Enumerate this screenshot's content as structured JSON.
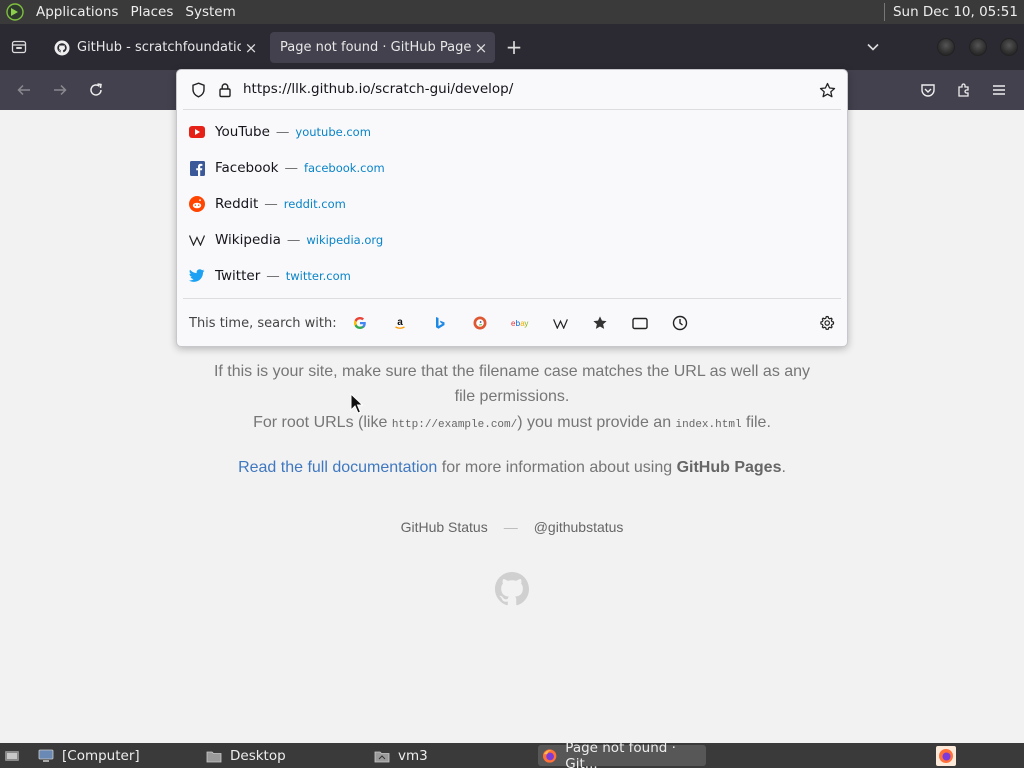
{
  "top_panel": {
    "menus": [
      "Applications",
      "Places",
      "System"
    ],
    "clock": "Sun Dec 10, 05:51"
  },
  "tabs": [
    {
      "title": "GitHub - scratchfoundation/",
      "close": "×"
    },
    {
      "title": "Page not found · GitHub Pages",
      "close": "×"
    }
  ],
  "new_tab": "+",
  "url_bar": {
    "value": "https://llk.github.io/scratch-gui/develop/"
  },
  "suggestions": [
    {
      "name": "YouTube",
      "sep": "—",
      "url": "youtube.com",
      "icon": "youtube-icon"
    },
    {
      "name": "Facebook",
      "sep": "—",
      "url": "facebook.com",
      "icon": "facebook-icon"
    },
    {
      "name": "Reddit",
      "sep": "—",
      "url": "reddit.com",
      "icon": "reddit-icon"
    },
    {
      "name": "Wikipedia",
      "sep": "—",
      "url": "wikipedia.org",
      "icon": "wikipedia-icon"
    },
    {
      "name": "Twitter",
      "sep": "—",
      "url": "twitter.com",
      "icon": "twitter-icon"
    }
  ],
  "search_with": {
    "label": "This time, search with:",
    "engines": [
      "google-icon",
      "amazon-icon",
      "bing-icon",
      "duckduckgo-icon",
      "ebay-icon",
      "wikipedia-icon",
      "bookmarks-icon",
      "tabs-icon",
      "history-icon"
    ]
  },
  "page": {
    "line1": "If this is your site, make sure that the filename case matches the URL as well as any",
    "line2": "file permissions.",
    "line3_pre": "For root URLs (like ",
    "line3_code1": "http://example.com/",
    "line3_mid": ") you must provide an ",
    "line3_code2": "index.html",
    "line3_post": " file.",
    "doc_link": "Read the full documentation",
    "doc_mid": " for more information about using ",
    "doc_strong": "GitHub Pages",
    "doc_end": ".",
    "footer_status": "GitHub Status",
    "footer_sep": "—",
    "footer_twitter": "@githubstatus"
  },
  "taskbar": {
    "items": [
      "[Computer]",
      "Desktop",
      "vm3",
      "Page not found · Git..."
    ]
  },
  "colors": {
    "accent_link": "#4078c0",
    "suggestion_url": "#0a84c8",
    "tab_active": "#42414d",
    "tabbar": "#2b2a33"
  }
}
